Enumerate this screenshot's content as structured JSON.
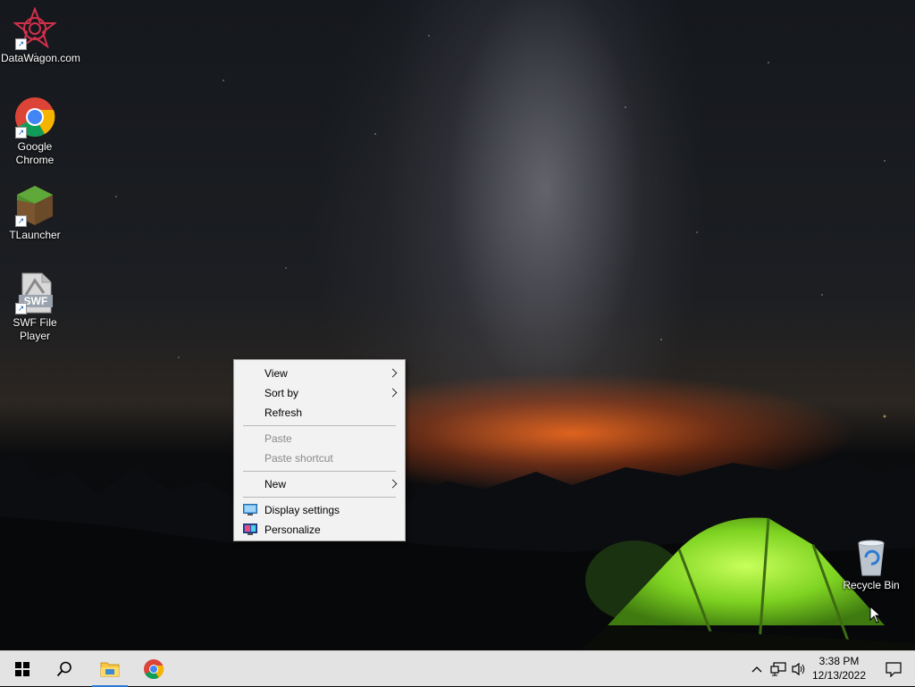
{
  "desktop": {
    "icons": [
      {
        "label": "DataWagon.com",
        "icon": "datawagon-icon"
      },
      {
        "label": "Google Chrome",
        "icon": "chrome-icon"
      },
      {
        "label": "TLauncher",
        "icon": "tlauncher-icon"
      },
      {
        "label": "SWF File Player",
        "icon": "swf-file-icon"
      },
      {
        "label": "Recycle Bin",
        "icon": "recycle-bin-icon"
      }
    ],
    "swf_badge": "SWF"
  },
  "context_menu": {
    "items": [
      {
        "label": "View",
        "submenu": true,
        "enabled": true
      },
      {
        "label": "Sort by",
        "submenu": true,
        "enabled": true
      },
      {
        "label": "Refresh",
        "submenu": false,
        "enabled": true
      },
      {
        "label": "Paste",
        "submenu": false,
        "enabled": false
      },
      {
        "label": "Paste shortcut",
        "submenu": false,
        "enabled": false
      },
      {
        "label": "New",
        "submenu": true,
        "enabled": true
      },
      {
        "label": "Display settings",
        "icon": "display-icon",
        "enabled": true
      },
      {
        "label": "Personalize",
        "icon": "personalize-icon",
        "enabled": true
      }
    ]
  },
  "taskbar": {
    "time": "3:38 PM",
    "date": "12/13/2022",
    "buttons": [
      "start-icon",
      "search-icon",
      "file-explorer-icon",
      "chrome-icon"
    ],
    "tray": [
      "chevron-up-icon",
      "network-icon",
      "volume-icon",
      "notification-icon"
    ]
  },
  "colors": {
    "taskbar_bg": "#e3e3e3",
    "menu_bg": "#f2f2f2",
    "accent": "#2a7ad4",
    "tent_green": "#8fe02a"
  }
}
